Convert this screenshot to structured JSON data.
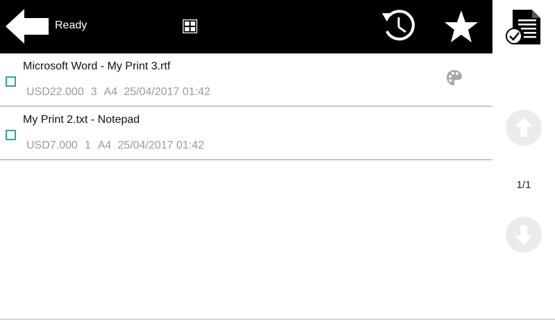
{
  "header": {
    "status_text": "Ready",
    "icons": {
      "back": "back-arrow-icon",
      "grid": "grid-icon",
      "history": "history-icon",
      "favorite": "star-icon"
    },
    "background": "#000000"
  },
  "sidebar": {
    "docs_icon": "document-check-icon",
    "page_indicator": "1/1",
    "scroll_up_icon": "arrow-up-icon",
    "scroll_down_icon": "arrow-down-icon"
  },
  "jobs": [
    {
      "title": "Microsoft Word - My Print 3.rtf",
      "price": "USD22.000",
      "copies": "3",
      "paper": "A4",
      "date": "25/04/2017 01:42",
      "color_icon": "palette-icon",
      "selected": false
    },
    {
      "title": "My Print 2.txt - Notepad",
      "price": "USD7.000",
      "copies": "1",
      "paper": "A4",
      "date": "25/04/2017 01:42",
      "selected": false
    }
  ],
  "colors": {
    "checkbox_accent": "#29a88c",
    "meta_text": "#9a9a9a",
    "disabled_button": "#ebebeb"
  }
}
